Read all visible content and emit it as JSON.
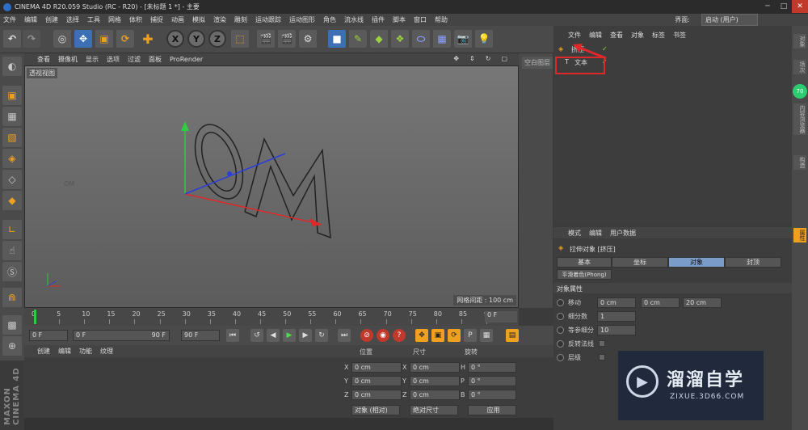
{
  "window": {
    "title": "CINEMA 4D R20.059 Studio (RC - R20) - [未标题 1 *] - 主要"
  },
  "menu": [
    "文件",
    "编辑",
    "创建",
    "选择",
    "工具",
    "网格",
    "体积",
    "捕捉",
    "动画",
    "模拟",
    "渲染",
    "雕刻",
    "运动跟踪",
    "运动图形",
    "角色",
    "流水线",
    "插件",
    "脚本",
    "窗口",
    "帮助"
  ],
  "layout": {
    "label": "界面:",
    "value": "启动 (用户)"
  },
  "toolbar": {
    "x": "X",
    "y": "Y",
    "z": "Z"
  },
  "viewport": {
    "menu": [
      "查看",
      "摄像机",
      "显示",
      "选项",
      "过滤",
      "面板",
      "ProRender"
    ],
    "label": "透视视图",
    "grid": "网格间距 : 100 cm",
    "text3d": "OM"
  },
  "camera_panel": "空白图层",
  "timeline": {
    "ticks": [
      "0",
      "5",
      "10",
      "15",
      "20",
      "25",
      "30",
      "35",
      "40",
      "45",
      "50",
      "55",
      "60",
      "65",
      "70",
      "75",
      "80",
      "85",
      "90"
    ],
    "end_frame": "0 F"
  },
  "playback": {
    "start": "0 F",
    "range_start": "0 F",
    "range_end": "90 F",
    "end": "90 F"
  },
  "materials": {
    "menu": [
      "创建",
      "编辑",
      "功能",
      "纹理"
    ]
  },
  "coords": {
    "headers": [
      "位置",
      "尺寸",
      "旋转"
    ],
    "rows": [
      {
        "axis": "X",
        "pos": "0 cm",
        "saxis": "X",
        "size": "0 cm",
        "raxis": "H",
        "rot": "0 °"
      },
      {
        "axis": "Y",
        "pos": "0 cm",
        "saxis": "Y",
        "size": "0 cm",
        "raxis": "P",
        "rot": "0 °"
      },
      {
        "axis": "Z",
        "pos": "0 cm",
        "saxis": "Z",
        "size": "0 cm",
        "raxis": "B",
        "rot": "0 °"
      }
    ],
    "mode": "对象 (相对)",
    "size_mode": "绝对尺寸",
    "apply": "应用"
  },
  "objects": {
    "menu": [
      "文件",
      "编辑",
      "查看",
      "对象",
      "标签",
      "书签"
    ],
    "items": [
      {
        "name": "挤压"
      },
      {
        "name": "文本"
      }
    ]
  },
  "attributes": {
    "menu": [
      "模式",
      "编辑",
      "用户数据"
    ],
    "title": "拉伸对象 [挤压]",
    "tabs": [
      "基本",
      "坐标",
      "对象",
      "封顶"
    ],
    "active_tab": "对象",
    "phong": "平滑着色(Phong)",
    "section": "对象属性",
    "move_label": "移动",
    "move": [
      "0 cm",
      "0 cm",
      "20 cm"
    ],
    "subdiv_label": "细分数",
    "subdiv": "1",
    "iso_label": "等参细分",
    "iso": "10",
    "flip_label": "反转法线",
    "layer_label": "层级"
  },
  "sidetabs": [
    "对象",
    "场次",
    "内容浏览器",
    "构造"
  ],
  "side_badge": "70",
  "attr_sidetab": "属性",
  "watermark": {
    "title": "溜溜自学",
    "url": "ZIXUE.3D66.COM"
  },
  "colors": {
    "accent": "#3c6fb3",
    "highlight": "#e0282a",
    "active_tab": "#7a9cc8"
  }
}
